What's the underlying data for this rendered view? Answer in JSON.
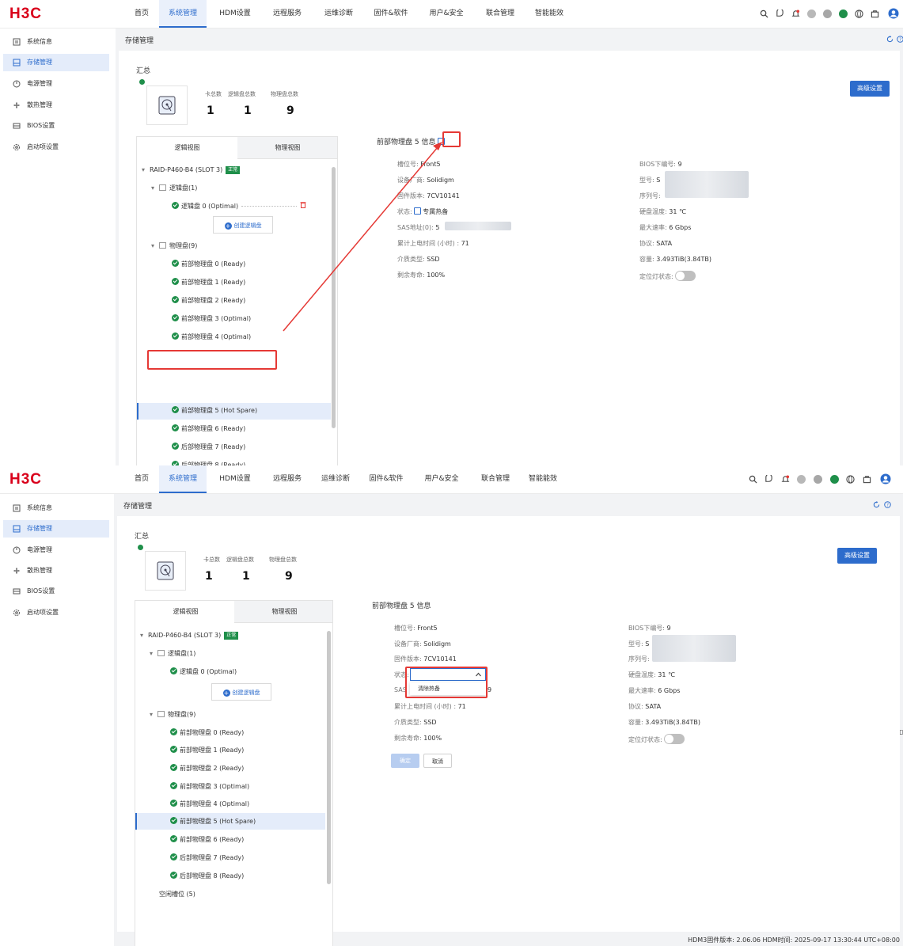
{
  "brand": "H3C",
  "nav": [
    "首页",
    "系统管理",
    "HDM设置",
    "远程服务",
    "运维诊断",
    "固件&软件",
    "用户&安全",
    "联合管理",
    "智能能效"
  ],
  "sidebar": [
    "系统信息",
    "存储管理",
    "电源管理",
    "散热管理",
    "BIOS设置",
    "启动项设置"
  ],
  "page_title": "存储管理",
  "summary": {
    "title": "汇总",
    "stats": [
      {
        "label": "卡总数",
        "value": "1"
      },
      {
        "label": "逻辑盘总数",
        "value": "1"
      },
      {
        "label": "物理盘总数",
        "value": "9"
      }
    ],
    "advanced_button": "高级设置"
  },
  "tabs": [
    "逻辑视图",
    "物理视图"
  ],
  "tree": {
    "controller": "RAID-P460-B4 (SLOT 3)",
    "controller_status": "正常",
    "logical_group": "逻辑盘(1)",
    "logical_disk": "逻辑盘 0 (Optimal)",
    "create_logical": "创建逻辑盘",
    "physical_group": "物理盘(9)",
    "disks": [
      "前部物理盘 0 (Ready)",
      "前部物理盘 1 (Ready)",
      "前部物理盘 2 (Ready)",
      "前部物理盘 3 (Optimal)",
      "前部物理盘 4 (Optimal)",
      "前部物理盘 5 (Hot Spare)",
      "前部物理盘 6 (Ready)",
      "后部物理盘 7 (Ready)",
      "后部物理盘 8 (Ready)"
    ],
    "free_slots": "空闲槽位 (5)"
  },
  "detail": {
    "title": "前部物理盘 5 信息",
    "left": [
      {
        "label": "槽位号:",
        "value": "Front5"
      },
      {
        "label": "设备厂商:",
        "value": "Solidigm"
      },
      {
        "label": "固件版本:",
        "value": "7CV10141"
      },
      {
        "label": "状态:",
        "value": "专属热备"
      },
      {
        "label": "SAS地址(0):",
        "value": "5"
      },
      {
        "label": "累计上电时间 (小时) :",
        "value": "71"
      },
      {
        "label": "介质类型:",
        "value": "SSD"
      },
      {
        "label": "剩余寿命:",
        "value": "100%"
      }
    ],
    "right": [
      {
        "label": "BIOS下编号:",
        "value": "9"
      },
      {
        "label": "型号:",
        "value": "S"
      },
      {
        "label": "序列号:",
        "value": ""
      },
      {
        "label": "硬盘温度:",
        "value": "31 ℃"
      },
      {
        "label": "最大速率:",
        "value": "6 Gbps"
      },
      {
        "label": "协议:",
        "value": "SATA"
      },
      {
        "label": "容量:",
        "value": "3.493TiB(3.84TB)"
      },
      {
        "label": "定位灯状态:",
        "value": ""
      }
    ]
  },
  "edit": {
    "status_label": "状态:",
    "sas_label": "SAS",
    "sas_tail": "9",
    "dropdown_option": "清除热备",
    "confirm": "确定",
    "cancel": "取消"
  },
  "footer": "HDM3固件版本: 2.06.06   HDM时间: 2025-09-17 13:30:44 UTC+08:00",
  "colors": {
    "accent": "#2d6ccc",
    "brand": "#d9001b",
    "ok": "#1f8f4a",
    "highlight": "#e53935"
  }
}
